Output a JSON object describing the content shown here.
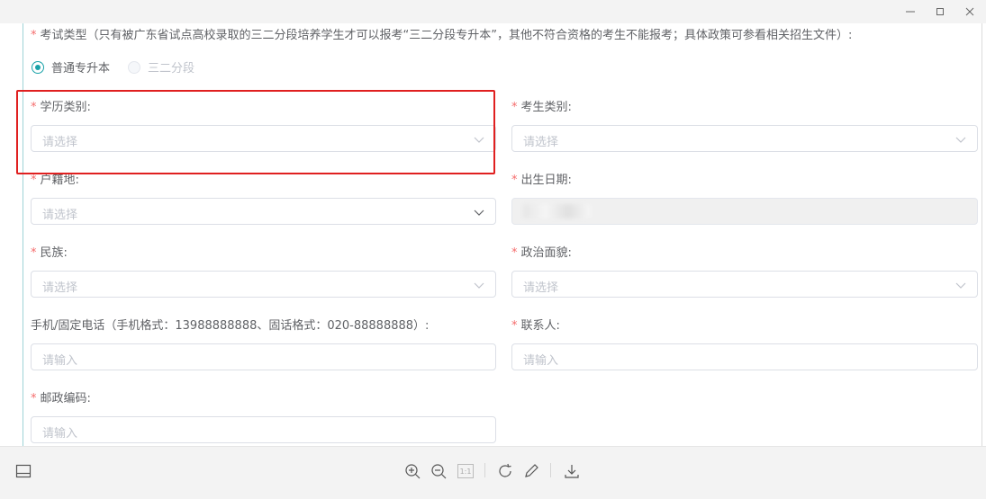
{
  "window": {
    "controls": [
      "minimize",
      "maximize",
      "close"
    ]
  },
  "form": {
    "exam_type_label": "考试类型（只有被广东省试点高校录取的三二分段培养学生才可以报考“三二分段专升本”，其他不符合资格的考生不能报考；具体政策可参看相关招生文件）:",
    "exam_type_options": [
      "普通专升本",
      "三二分段"
    ],
    "exam_type_selected": "普通专升本",
    "education_label": "学历类别:",
    "education_placeholder": "请选择",
    "candidate_type_label": "考生类别:",
    "candidate_type_placeholder": "请选择",
    "household_label": "户籍地:",
    "household_placeholder": "请选择",
    "birth_label": "出生日期:",
    "ethnicity_label": "民族:",
    "ethnicity_placeholder": "请选择",
    "politics_label": "政治面貌:",
    "politics_placeholder": "请选择",
    "phone_label": "手机/固定电话（手机格式：13988888888、固话格式：020-88888888）:",
    "phone_placeholder": "请输入",
    "contact_label": "联系人:",
    "contact_placeholder": "请输入",
    "postcode_label": "邮政编码:",
    "postcode_placeholder": "请输入",
    "required_mark": "*"
  },
  "colors": {
    "accent": "#19a2a8",
    "required": "#f56c6c",
    "highlight": "#e02020"
  },
  "toolbar": {
    "icons": [
      "panel-icon",
      "zoom-in-icon",
      "zoom-out-icon",
      "actual-size-icon",
      "rotate-icon",
      "edit-icon",
      "download-icon"
    ],
    "actual_size_label": "1:1"
  }
}
